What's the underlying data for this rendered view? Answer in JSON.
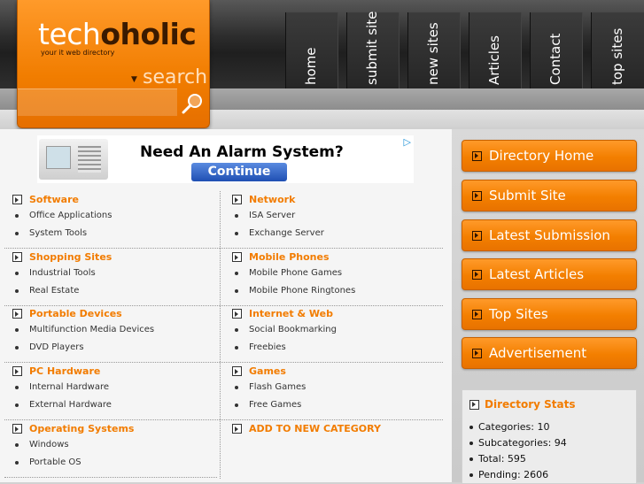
{
  "brand": {
    "name_part1": "tech",
    "name_part2": "oholic",
    "tagline": "your it web directory",
    "search_label": "search",
    "color": "#f27c00"
  },
  "nav": [
    {
      "label": "home"
    },
    {
      "label": "submit site"
    },
    {
      "label": "new sites"
    },
    {
      "label": "Articles"
    },
    {
      "label": "Contact"
    },
    {
      "label": "top sites"
    }
  ],
  "ad": {
    "headline": "Need An Alarm System?",
    "button": "Continue",
    "badge_icon": "adchoices-icon"
  },
  "categories": [
    {
      "title": "Software",
      "items": [
        "Office Applications",
        "System Tools"
      ]
    },
    {
      "title": "Network",
      "items": [
        "ISA Server",
        "Exchange Server"
      ]
    },
    {
      "title": "Shopping Sites",
      "items": [
        "Industrial Tools",
        "Real Estate"
      ]
    },
    {
      "title": "Mobile Phones",
      "items": [
        "Mobile Phone Games",
        "Mobile Phone Ringtones"
      ]
    },
    {
      "title": "Portable Devices",
      "items": [
        "Multifunction Media Devices",
        "DVD Players"
      ]
    },
    {
      "title": "Internet & Web",
      "items": [
        "Social Bookmarking",
        "Freebies"
      ]
    },
    {
      "title": "PC Hardware",
      "items": [
        "Internal Hardware",
        "External Hardware"
      ]
    },
    {
      "title": "Games",
      "items": [
        "Flash Games",
        "Free Games"
      ]
    },
    {
      "title": "Operating Systems",
      "items": [
        "Windows",
        "Portable OS"
      ]
    }
  ],
  "add_category": "ADD TO NEW CATEGORY",
  "sidebar": {
    "buttons": [
      {
        "label": "Directory Home"
      },
      {
        "label": "Submit Site"
      },
      {
        "label": "Latest Submission"
      },
      {
        "label": "Latest Articles"
      },
      {
        "label": "Top Sites"
      },
      {
        "label": "Advertisement"
      }
    ]
  },
  "stats": {
    "title": "Directory Stats",
    "rows": [
      "Categories: 10",
      "Subcategories: 94",
      "Total: 595",
      "Pending: 2606"
    ]
  }
}
